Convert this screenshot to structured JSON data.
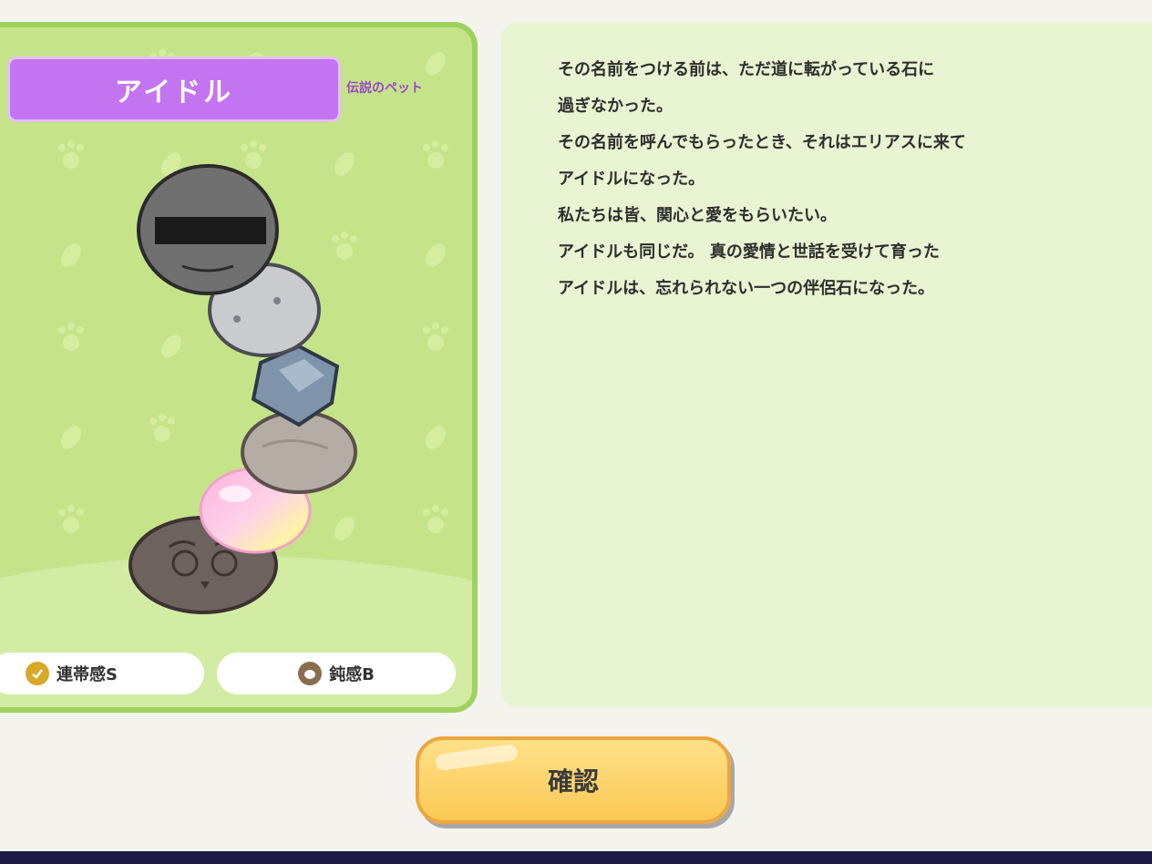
{
  "pet": {
    "name": "アイドル",
    "rarity": "伝説のペット",
    "traits": [
      {
        "label": "連帯感S",
        "icon": "link-badge-icon",
        "color": "#d9a827"
      },
      {
        "label": "鈍感B",
        "icon": "stone-badge-icon",
        "color": "#8a6d4e"
      }
    ]
  },
  "description": {
    "lines": [
      "その名前をつける前は、ただ道に転がっている石に",
      "過ぎなかった。",
      "その名前を呼んでもらったとき、それはエリアスに来て",
      "アイドルになった。",
      "私たちは皆、関心と愛をもらいたい。",
      "アイドルも同じだ。 真の愛情と世話を受けて育った",
      "アイドルは、忘れられない一つの伴侶石になった。"
    ]
  },
  "actions": {
    "confirm_label": "確認"
  },
  "colors": {
    "card_bg": "#c5e48a",
    "title_bg": "#c374f0",
    "panel_bg": "#e9f4d2",
    "button": "#fbc954"
  }
}
